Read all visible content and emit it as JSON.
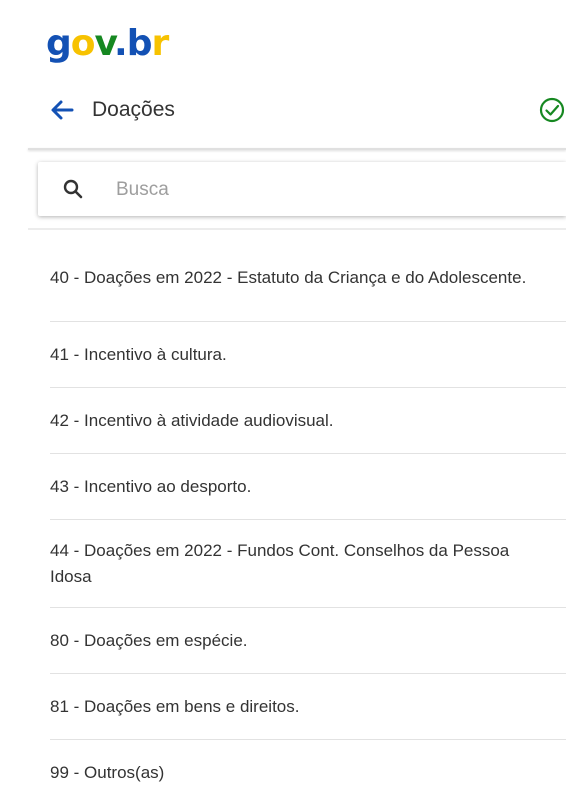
{
  "logo": {
    "part1": "g",
    "part2": "o",
    "part3": "v",
    "part4": ".",
    "part5": "b",
    "part6": "r"
  },
  "header": {
    "title": "Doações"
  },
  "search": {
    "placeholder": "Busca"
  },
  "items": [
    {
      "label": "40 - Doações em 2022 - Estatuto da Criança e do Adolescente."
    },
    {
      "label": "41 - Incentivo à cultura."
    },
    {
      "label": "42 - Incentivo à atividade audiovisual."
    },
    {
      "label": "43 - Incentivo ao desporto."
    },
    {
      "label": "44 - Doações em 2022 - Fundos Cont. Conselhos da Pessoa Idosa"
    },
    {
      "label": "80 - Doações em espécie."
    },
    {
      "label": "81 - Doações em bens e direitos."
    },
    {
      "label": "99 - Outros(as)"
    }
  ],
  "colors": {
    "brand_blue": "#1351b4",
    "brand_yellow": "#f7c200",
    "brand_green": "#168821",
    "check_green": "#168821"
  },
  "icons": {
    "back": "arrow-left-icon",
    "confirm": "check-circle-icon",
    "search": "search-icon"
  }
}
